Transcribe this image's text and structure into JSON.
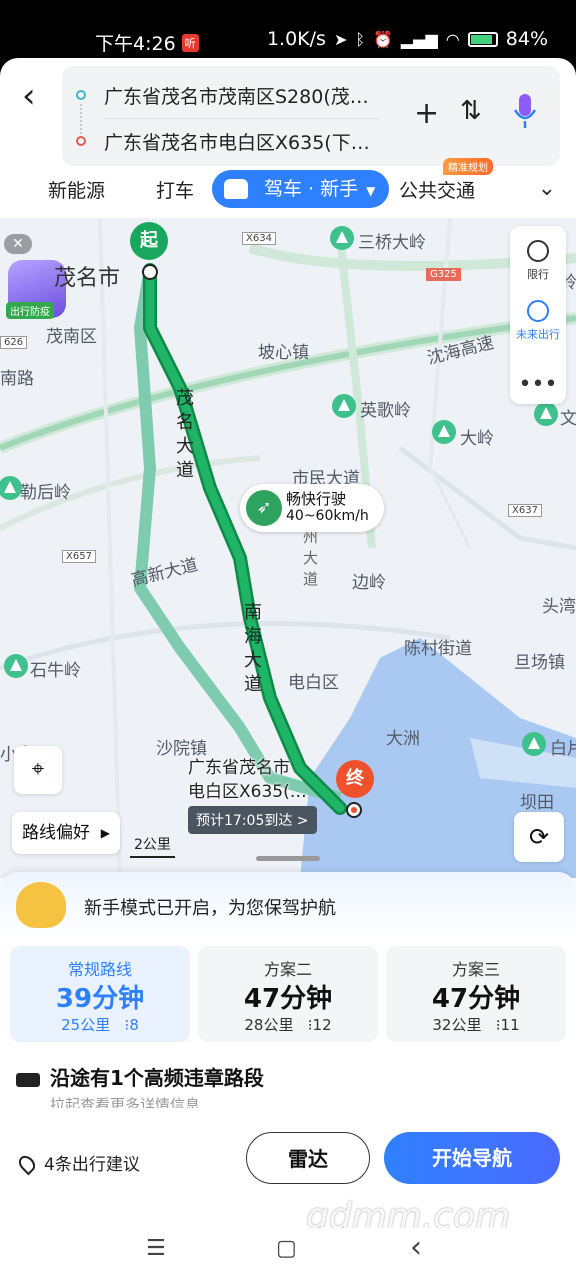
{
  "status_bar": {
    "time": "下午4:26",
    "badge": "听",
    "speed": "1.0K/s",
    "battery": "84%",
    "battery_level": 0.84
  },
  "header": {
    "back_icon": "chevron-left-icon",
    "start": "广东省茂名市茂南区S280(茂…",
    "end": "广东省茂名市电白区X635(下…",
    "add_label": "+",
    "swap_icon": "swap-icon",
    "mic_icon": "microphone-icon"
  },
  "modes": {
    "items": [
      "新能源",
      "打车",
      "驾车 · 新手",
      "公共交通"
    ],
    "active_index": 2,
    "tag": "精准规划"
  },
  "map": {
    "close": "✕",
    "mascot_label": "出行防疫",
    "labels": {
      "city": "茂名市",
      "maonan": "茂南区",
      "nanlu": "南路",
      "poxin": "坡心镇",
      "sanqiao": "三桥大岭",
      "yingge": "英歌岭",
      "dashan": "大岭",
      "wen": "文",
      "leho": "勒后岭",
      "shimin": "市民大道",
      "bianling": "边岭",
      "chencun": "陈村街道",
      "toushi": "头湾",
      "dangchang": "旦场镇",
      "shiniu": "石牛岭",
      "dianbai": "电白区",
      "dazhou": "大洲",
      "baishan": "白片",
      "shaoyuan": "沙院镇",
      "xiaoliang": "小良",
      "bacheng": "坝田",
      "gaoxin": "高新大道",
      "haibei": "沈海高速",
      "ling": "岭",
      "zhou": "南州大道"
    },
    "road_tags": [
      "X634",
      "G325",
      "626",
      "X657",
      "X637"
    ],
    "road_maoming": "茂名大道",
    "road_nanhai": "南海大道",
    "start_pin": "起",
    "end_pin": "终",
    "speed_title": "畅快行驶",
    "speed_range": "40~60km/h",
    "dest_line1": "广东省茂名市",
    "dest_line2": "电白区X635(…",
    "eta": "预计17:05到达 >",
    "tools": {
      "limit": "限行",
      "future": "未来出行",
      "more": "•••"
    },
    "locate_icon": "locate-icon",
    "route_pref": "路线偏好",
    "scale": "2公里",
    "refresh_icon": "refresh-icon"
  },
  "panel": {
    "novice_text": "新手模式已开启，为您保驾护航",
    "routes": [
      {
        "name": "常规路线",
        "time": "39分钟",
        "distance": "25公里",
        "lights": "8"
      },
      {
        "name": "方案二",
        "time": "47分钟",
        "distance": "28公里",
        "lights": "12"
      },
      {
        "name": "方案三",
        "time": "47分钟",
        "distance": "32公里",
        "lights": "11"
      }
    ],
    "violation": "沿途有1个高频违章路段",
    "subhint": "拉起查看更多详情信息",
    "advice": "4条出行建议",
    "radar": "雷达",
    "navigate": "开始导航"
  },
  "watermark": "gdmm.com",
  "navbar": {
    "menu": "☰",
    "home": "▢",
    "back": "‹"
  },
  "colors": {
    "accent": "#2f80ff",
    "route_green": "#19a75d",
    "end_red": "#f0512d"
  }
}
